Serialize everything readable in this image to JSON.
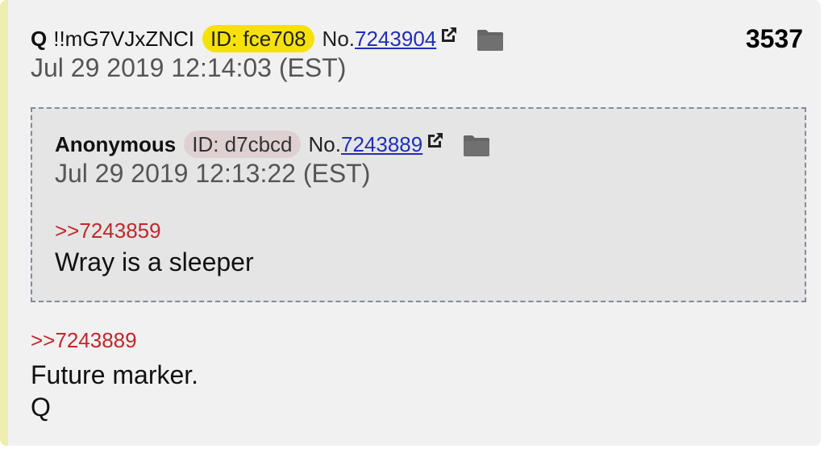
{
  "post": {
    "name": "Q",
    "tripcode": "!!mG7VJxZNCI",
    "id_label": "ID: fce708",
    "number_prefix": "No.",
    "number": "7243904",
    "post_count": "3537",
    "date": "Jul 29 2019 12:14:03 (EST)",
    "reply_link": ">>7243889",
    "body_lines": [
      "Future marker.",
      "Q"
    ],
    "id_color": "#f7e10a"
  },
  "quoted": {
    "name": "Anonymous",
    "id_label": "ID: d7cbcd",
    "number_prefix": "No.",
    "number": "7243889",
    "date": "Jul 29 2019 12:13:22 (EST)",
    "reply_link": ">>7243859",
    "body": "Wray is a sleeper",
    "id_color": "#dfd1d1"
  },
  "colors": {
    "card_bg": "#f1f1f1",
    "accent_border": "#eeeeae",
    "link": "#1f2fb8",
    "reply_link": "#c0282a"
  },
  "icons": [
    "external-link-icon",
    "folder-icon"
  ]
}
